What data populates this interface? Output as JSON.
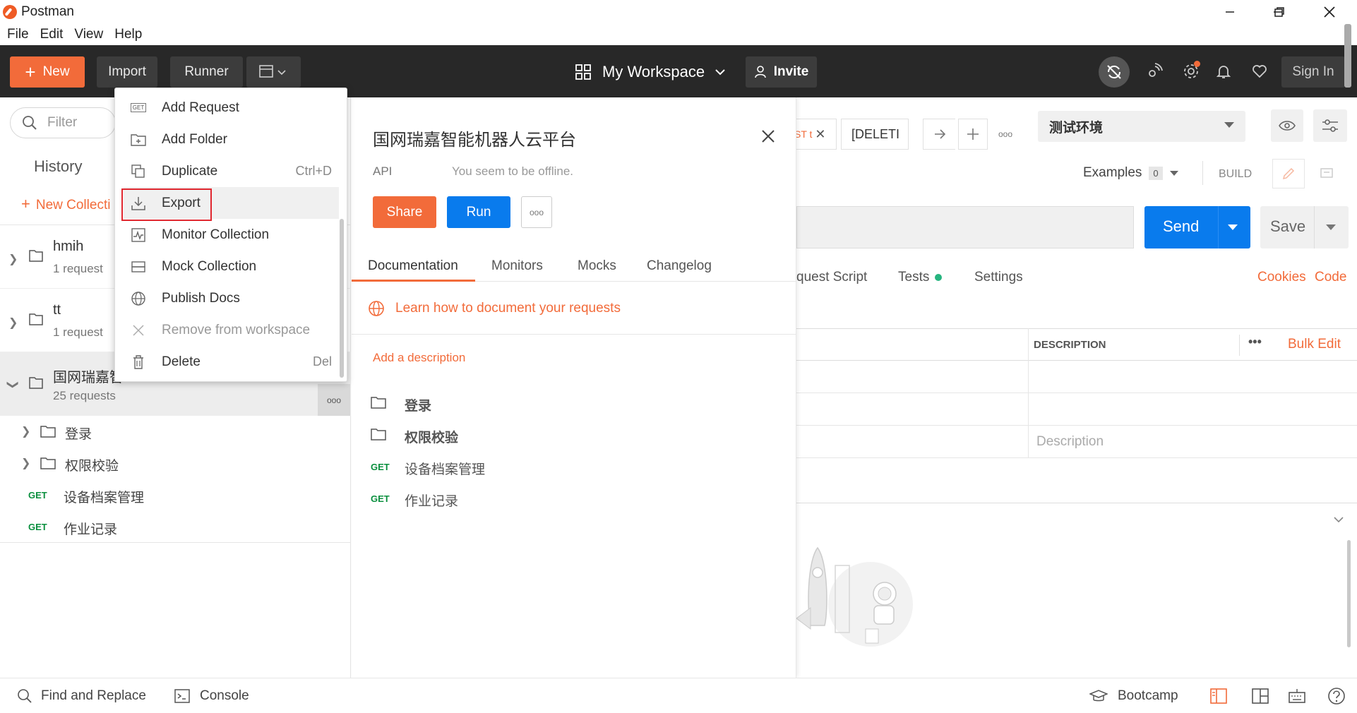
{
  "window": {
    "title": "Postman"
  },
  "menubar": [
    "File",
    "Edit",
    "View",
    "Help"
  ],
  "header": {
    "new_label": "New",
    "import_label": "Import",
    "runner_label": "Runner",
    "workspace_label": "My Workspace",
    "invite_label": "Invite",
    "signin_label": "Sign In"
  },
  "sidebar": {
    "filter_placeholder": "Filter",
    "history_label": "History",
    "new_collection_label": "New Collecti",
    "collections": [
      {
        "name": "hmih",
        "sub": "1 request"
      },
      {
        "name": "tt",
        "sub": "1 request"
      },
      {
        "name": "国网瑞嘉智",
        "sub": "25 requests"
      }
    ],
    "children": [
      {
        "type": "folder",
        "name": "登录"
      },
      {
        "type": "folder",
        "name": "权限校验"
      },
      {
        "type": "request",
        "method": "GET",
        "name": "设备档案管理"
      },
      {
        "type": "request",
        "method": "GET",
        "name": "作业记录"
      }
    ]
  },
  "context_menu": {
    "items": [
      {
        "label": "Add Request",
        "shortcut": ""
      },
      {
        "label": "Add Folder",
        "shortcut": ""
      },
      {
        "label": "Duplicate",
        "shortcut": "Ctrl+D"
      },
      {
        "label": "Export",
        "shortcut": ""
      },
      {
        "label": "Monitor Collection",
        "shortcut": ""
      },
      {
        "label": "Mock Collection",
        "shortcut": ""
      },
      {
        "label": "Publish Docs",
        "shortcut": ""
      },
      {
        "label": "Remove from workspace",
        "shortcut": ""
      },
      {
        "label": "Delete",
        "shortcut": "Del"
      }
    ],
    "highlighted": "Export"
  },
  "details": {
    "title": "国网瑞嘉智能机器人云平台",
    "api_label": "API",
    "offline_text": "You seem to be offline.",
    "share_label": "Share",
    "run_label": "Run",
    "tabs": [
      "Documentation",
      "Monitors",
      "Mocks",
      "Changelog"
    ],
    "learn_text": "Learn how to document your requests",
    "add_description": "Add a description",
    "items": [
      {
        "type": "folder",
        "name": "登录"
      },
      {
        "type": "folder",
        "name": "权限校验"
      },
      {
        "type": "request",
        "method": "GET",
        "name": "设备档案管理"
      },
      {
        "type": "request",
        "method": "GET",
        "name": "作业记录"
      }
    ]
  },
  "request": {
    "tab1": "ST t",
    "tab2": "[DELETI",
    "environment": "测试环境",
    "examples_label": "Examples",
    "examples_count": "0",
    "build_label": "BUILD",
    "send_label": "Send",
    "save_label": "Save",
    "tabs": [
      "quest Script",
      "Tests",
      "Settings"
    ],
    "cookies_label": "Cookies",
    "code_label": "Code",
    "table_description_header": "DESCRIPTION",
    "bulk_edit_label": "Bulk Edit",
    "description_placeholder": "Description"
  },
  "statusbar": {
    "find_replace": "Find and Replace",
    "console": "Console",
    "bootcamp": "Bootcamp"
  },
  "colors": {
    "brand_orange": "#f26b3a",
    "primary_blue": "#097bed",
    "header_dark": "#282828",
    "get_green": "#0a8f3e",
    "highlight_red": "#e0272f"
  }
}
